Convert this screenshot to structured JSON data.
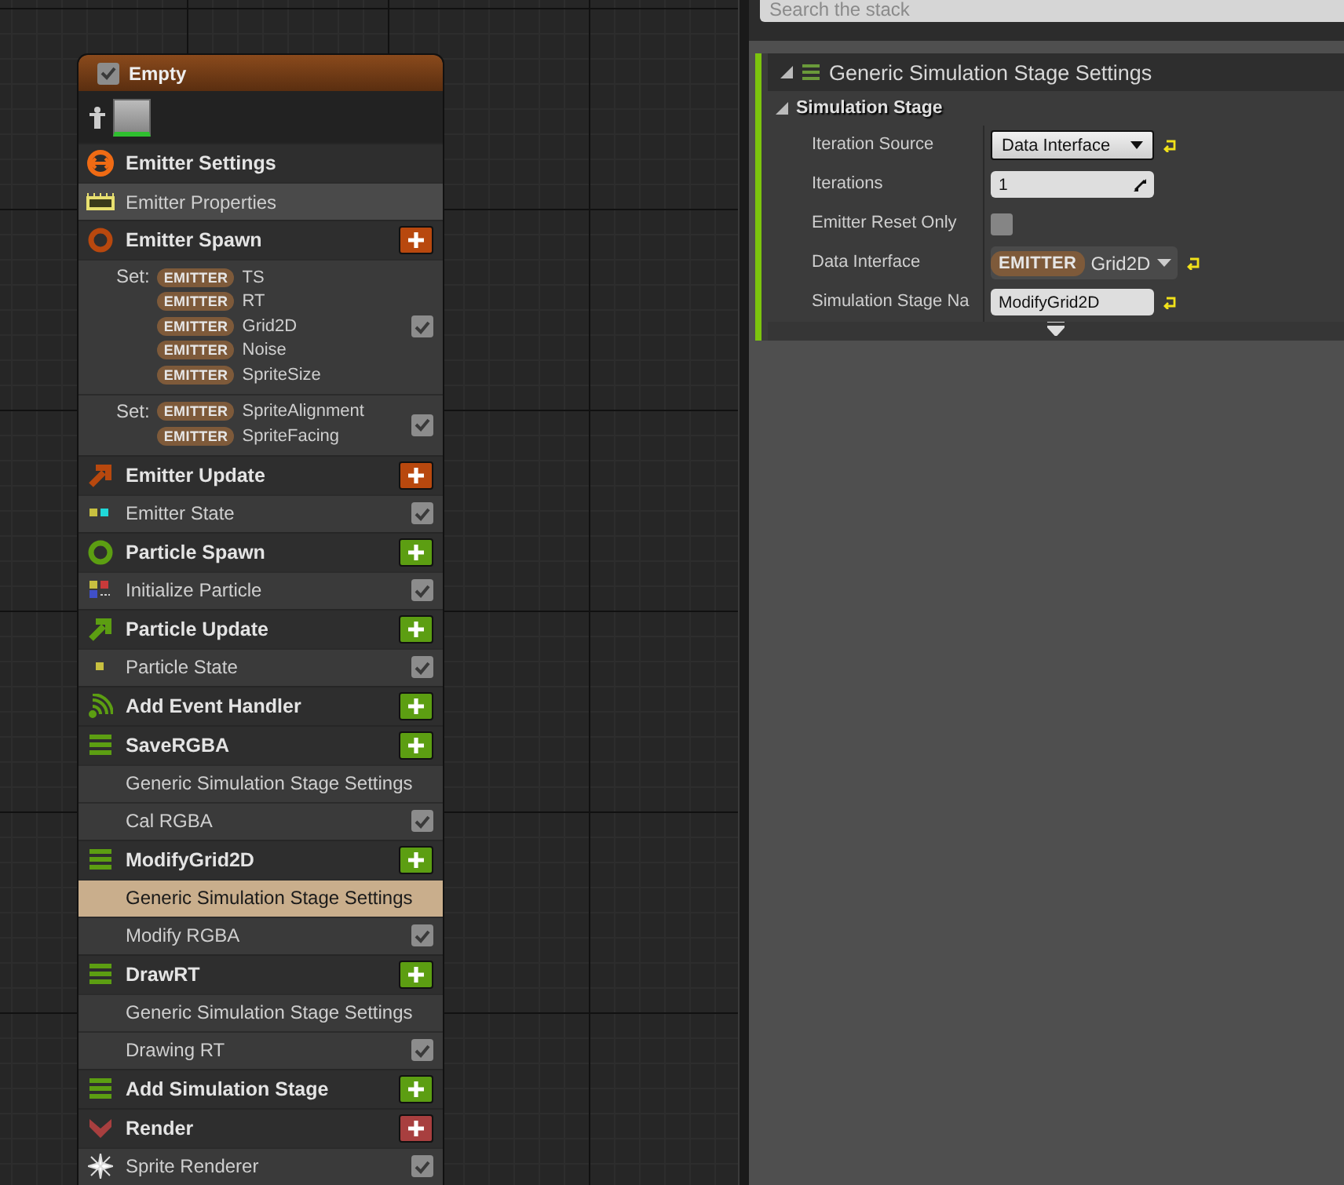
{
  "node": {
    "title": "Empty",
    "enabled": true,
    "sections": [
      {
        "title": "Emitter Settings",
        "kind": "settings",
        "items": [
          {
            "kind": "properties",
            "label": "Emitter Properties",
            "selected": false
          }
        ]
      },
      {
        "title": "Emitter Spawn",
        "kind": "spawn",
        "color": "#b8480e",
        "items": [
          {
            "kind": "set",
            "prefix": "Set:",
            "params": [
              {
                "tag": "EMITTER",
                "name": "TS"
              },
              {
                "tag": "EMITTER",
                "name": "RT"
              },
              {
                "tag": "EMITTER",
                "name": "Grid2D"
              },
              {
                "tag": "EMITTER",
                "name": "Noise"
              },
              {
                "tag": "EMITTER",
                "name": "SpriteSize"
              }
            ],
            "checked": true,
            "selected": false
          },
          {
            "kind": "set",
            "prefix": "Set:",
            "params": [
              {
                "tag": "EMITTER",
                "name": "SpriteAlignment"
              },
              {
                "tag": "EMITTER",
                "name": "SpriteFacing"
              }
            ],
            "checked": true,
            "selected": false
          }
        ]
      },
      {
        "title": "Emitter Update",
        "kind": "update",
        "color": "#b8480e",
        "items": [
          {
            "kind": "emitter-state",
            "label": "Emitter State",
            "checked": true,
            "selected": false
          }
        ]
      },
      {
        "title": "Particle Spawn",
        "kind": "spawn",
        "color": "#5c9e12",
        "items": [
          {
            "kind": "initialize",
            "label": "Initialize Particle",
            "checked": true,
            "selected": false
          }
        ]
      },
      {
        "title": "Particle Update",
        "kind": "update",
        "color": "#5c9e12",
        "items": [
          {
            "kind": "particle-state",
            "label": "Particle State",
            "checked": true,
            "selected": false
          }
        ]
      },
      {
        "title": "Add Event Handler",
        "kind": "event",
        "color": "#5c9e12"
      },
      {
        "title": "SaveRGBA",
        "kind": "stage",
        "color": "#5c9e12",
        "items": [
          {
            "kind": "stage-settings",
            "label": "Generic Simulation Stage Settings",
            "selected": false
          },
          {
            "kind": "module",
            "label": "Cal RGBA",
            "checked": true,
            "selected": false
          }
        ]
      },
      {
        "title": "ModifyGrid2D",
        "kind": "stage",
        "color": "#5c9e12",
        "items": [
          {
            "kind": "stage-settings",
            "label": "Generic Simulation Stage Settings",
            "selected": true
          },
          {
            "kind": "module",
            "label": "Modify RGBA",
            "checked": true,
            "selected": false
          }
        ]
      },
      {
        "title": "DrawRT",
        "kind": "stage",
        "color": "#5c9e12",
        "items": [
          {
            "kind": "stage-settings",
            "label": "Generic Simulation Stage Settings",
            "selected": false
          },
          {
            "kind": "module",
            "label": "Drawing RT",
            "checked": true,
            "selected": false
          }
        ]
      },
      {
        "title": "Add Simulation Stage",
        "kind": "stage",
        "color": "#5c9e12"
      },
      {
        "title": "Render",
        "kind": "render",
        "color": "#a83f3f",
        "items": [
          {
            "kind": "renderer",
            "label": "Sprite Renderer",
            "checked": true,
            "selected": false
          }
        ]
      }
    ]
  },
  "stack": {
    "search": {
      "placeholder": "Search the stack"
    },
    "panel": {
      "title": "Generic Simulation Stage Settings",
      "expanded": true,
      "category": {
        "title": "Simulation Stage",
        "expanded": true,
        "properties": [
          {
            "kind": "dropdown",
            "label": "Iteration Source",
            "value": "Data Interface",
            "resettable": true
          },
          {
            "kind": "number",
            "label": "Iterations",
            "value": "1",
            "resettable": false
          },
          {
            "kind": "checkbox",
            "label": "Emitter Reset Only",
            "checked": false,
            "resettable": false
          },
          {
            "kind": "object",
            "label": "Data Interface",
            "tag": "EMITTER",
            "value": "Grid2D",
            "resettable": true
          },
          {
            "kind": "text",
            "label": "Simulation Stage Na",
            "value": "ModifyGrid2D",
            "resettable": true
          }
        ]
      }
    }
  }
}
